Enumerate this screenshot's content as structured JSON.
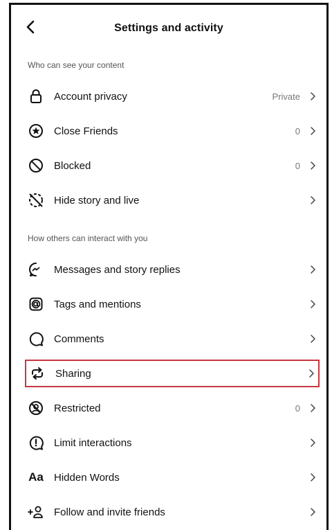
{
  "header": {
    "title": "Settings and activity"
  },
  "sections": {
    "visibility": "Who can see your content",
    "interaction": "How others can interact with you"
  },
  "items": {
    "account_privacy": {
      "label": "Account privacy",
      "value": "Private"
    },
    "close_friends": {
      "label": "Close Friends",
      "value": "0"
    },
    "blocked": {
      "label": "Blocked",
      "value": "0"
    },
    "hide_story": {
      "label": "Hide story and live"
    },
    "messages": {
      "label": "Messages and story replies"
    },
    "tags": {
      "label": "Tags and mentions"
    },
    "comments": {
      "label": "Comments"
    },
    "sharing": {
      "label": "Sharing"
    },
    "restricted": {
      "label": "Restricted",
      "value": "0"
    },
    "limit": {
      "label": "Limit interactions"
    },
    "hidden_words": {
      "label": "Hidden Words",
      "icon_text": "Aa"
    },
    "follow_invite": {
      "label": "Follow and invite friends"
    }
  },
  "colors": {
    "highlight": "#c8363f",
    "secondary_text": "#777777"
  }
}
